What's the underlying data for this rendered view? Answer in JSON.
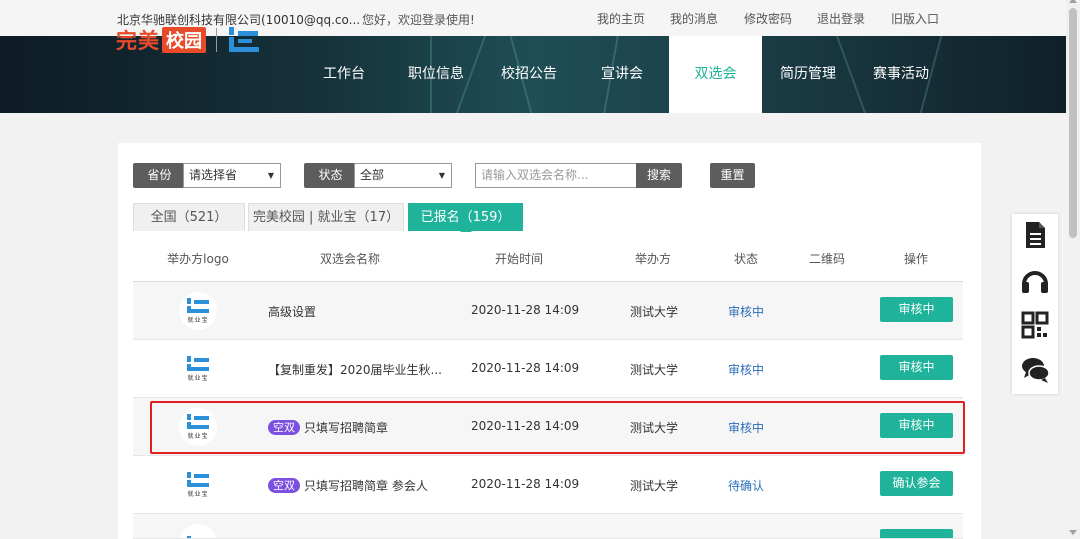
{
  "topbar": {
    "company": "北京华驰联创科技有限公司(10010@qq.co...",
    "greeting": "您好，欢迎登录使用!",
    "links": [
      "我的主页",
      "我的消息",
      "修改密码",
      "退出登录",
      "旧版入口"
    ]
  },
  "logo": {
    "part1": "完美",
    "part2": "校园"
  },
  "nav": {
    "items": [
      "工作台",
      "职位信息",
      "校招公告",
      "宣讲会",
      "双选会",
      "简历管理",
      "赛事活动"
    ],
    "active_index": 4
  },
  "filters": {
    "province_label": "省份",
    "province_value": "请选择省",
    "status_label": "状态",
    "status_value": "全部",
    "search_placeholder": "请输入双选会名称...",
    "search_button": "搜索",
    "reset_button": "重置"
  },
  "tabs": [
    {
      "label": "全国（521）"
    },
    {
      "label": "完美校园 | 就业宝（17）"
    },
    {
      "label": "已报名（159）"
    }
  ],
  "table": {
    "headers": [
      "举办方logo",
      "双选会名称",
      "开始时间",
      "举办方",
      "状态",
      "二维码",
      "操作"
    ],
    "logo_caption": "就业宝",
    "rows": [
      {
        "tag": "",
        "name": "高级设置",
        "time": "2020-11-28 14:09",
        "org": "测试大学",
        "status": "审核中",
        "action": "审核中"
      },
      {
        "tag": "",
        "name": "【复制重发】2020届毕业生秋...",
        "time": "2020-11-28 14:09",
        "org": "测试大学",
        "status": "审核中",
        "action": "审核中"
      },
      {
        "tag": "空双",
        "name": "只填写招聘简章",
        "time": "2020-11-28 14:09",
        "org": "测试大学",
        "status": "审核中",
        "action": "审核中"
      },
      {
        "tag": "空双",
        "name": "只填写招聘简章 参会人",
        "time": "2020-11-28 14:09",
        "org": "测试大学",
        "status": "待确认",
        "action": "确认参会"
      }
    ]
  },
  "colors": {
    "accent": "#1eb39a",
    "brand": "#e84b2a",
    "status_link": "#2c6fb8",
    "tag": "#7b4fe0",
    "highlight": "#e02020"
  }
}
